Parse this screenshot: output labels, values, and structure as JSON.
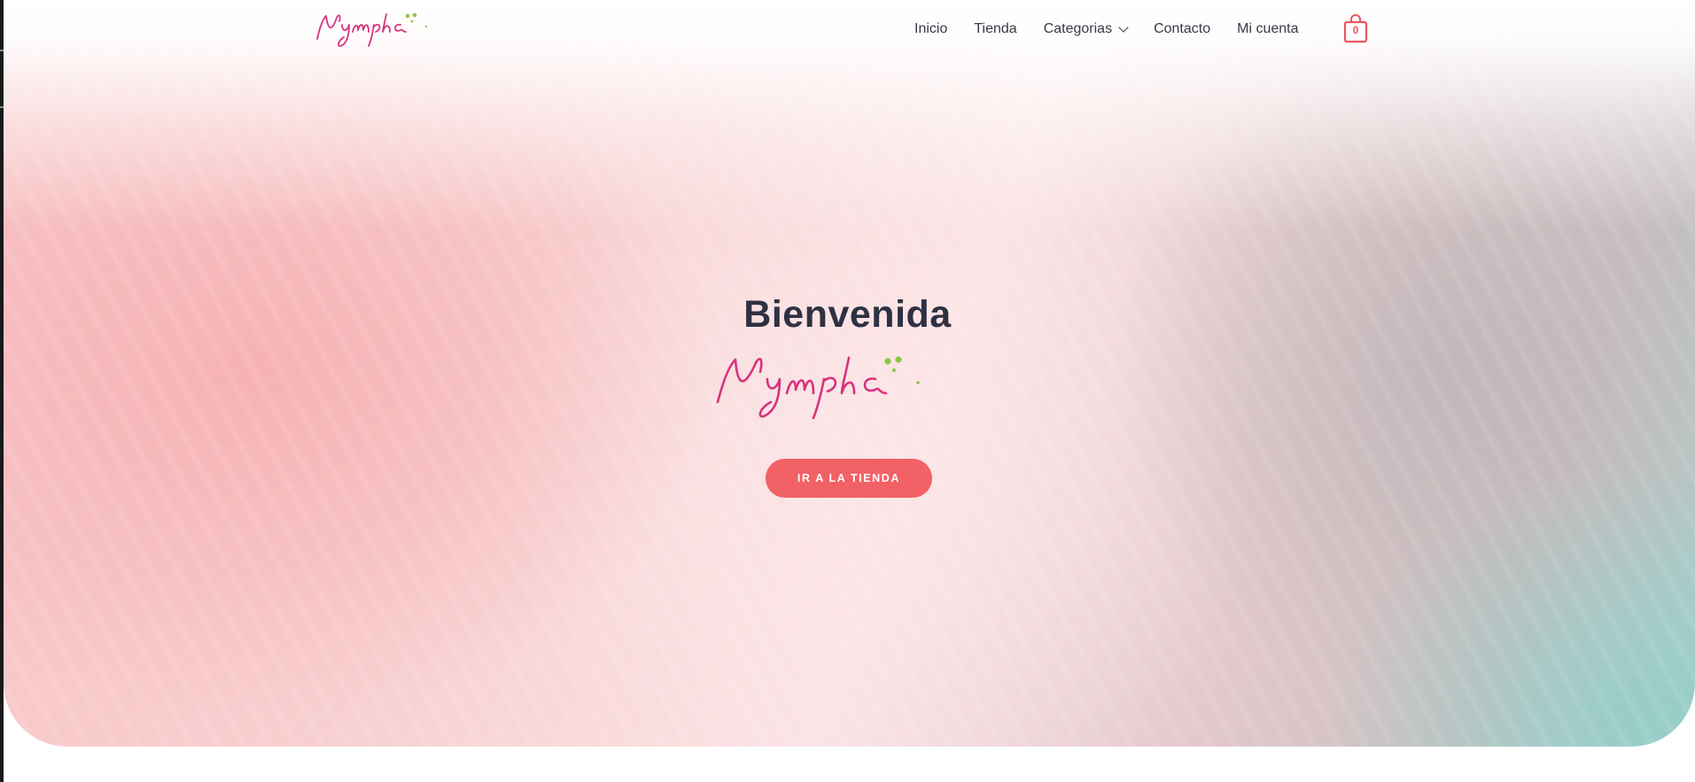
{
  "brand": {
    "name": "Nymphā",
    "script_color": "#d8327f",
    "dot_color": "#8dc63f"
  },
  "nav": {
    "items": [
      {
        "label": "Inicio"
      },
      {
        "label": "Tienda"
      },
      {
        "label": "Categorias",
        "has_dropdown": true
      },
      {
        "label": "Contacto"
      },
      {
        "label": "Mi cuenta"
      }
    ],
    "cart": {
      "count": "0",
      "icon": "shopping-bag-icon",
      "color": "#e8585f"
    }
  },
  "hero": {
    "title": "Bienvenida",
    "cta_label": "IR A LA TIENDA",
    "cta_color": "#f26165",
    "title_color": "#2e3141"
  }
}
